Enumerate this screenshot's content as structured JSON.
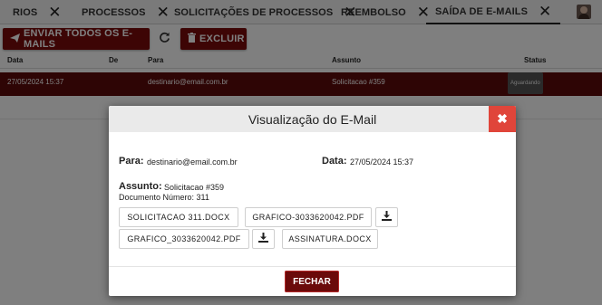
{
  "tabs": [
    {
      "label": "RIOS"
    },
    {
      "label": "PROCESSOS"
    },
    {
      "label": "SOLICITAÇÕES DE PROCESSOS"
    },
    {
      "label": "REEMBOLSO"
    },
    {
      "label": "SAÍDA DE E-MAILS",
      "active": true
    }
  ],
  "toolbar": {
    "send_all_label": "ENVIAR TODOS OS E-MAILS",
    "delete_label": "EXCLUIR"
  },
  "table": {
    "headers": [
      "Data",
      "De",
      "Para",
      "Assunto",
      "Status"
    ],
    "rows": [
      {
        "data": "27/05/2024 15:37",
        "de": "",
        "para": "destinario@email.com.br",
        "assunto": "Solicitacao #359",
        "status": "Aguardando"
      }
    ]
  },
  "modal": {
    "title": "Visualização do E-Mail",
    "para_label": "Para:",
    "para_value": "destinario@email.com.br",
    "data_label": "Data:",
    "data_value": "27/05/2024 15:37",
    "assunto_label": "Assunto:",
    "assunto_value": "Solicitacao #359",
    "documento": "Documento Número: 311",
    "attachments": [
      "SOLICITACAO 311.DOCX",
      "GRAFICO-3033620042.PDF",
      "GRAFICO_3033620042.PDF",
      "ASSINATURA.DOCX"
    ],
    "close_label": "FECHAR"
  },
  "colors": {
    "primary": "#7a0a0a",
    "row_selected": "#5c0a0a",
    "close_red": "#e0453a"
  }
}
